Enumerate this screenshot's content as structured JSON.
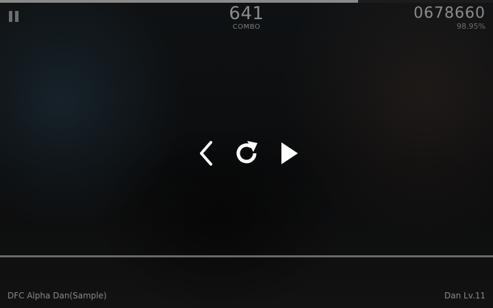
{
  "hud": {
    "progress": 0.727,
    "combo_count": "641",
    "combo_label": "COMBO",
    "score": "0678660",
    "accuracy": "98.95%"
  },
  "pause_menu": {
    "back_icon": "chevron-left-icon",
    "retry_icon": "restart-icon",
    "resume_icon": "play-icon"
  },
  "song": {
    "title": "DFC Alpha Dan(Sample)",
    "level": "Dan Lv.11"
  },
  "colors": {
    "background": "#0b0b0c",
    "hud_text": "#8c8c8c",
    "icon": "#ffffff",
    "judge_line": "#6a6a6a"
  }
}
